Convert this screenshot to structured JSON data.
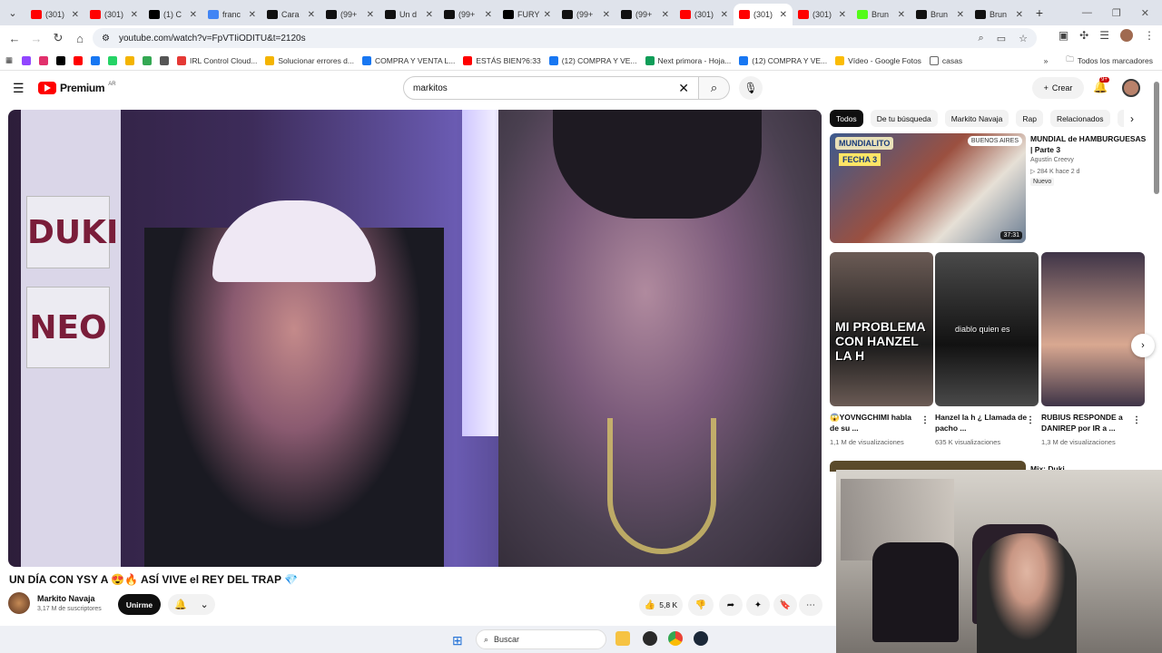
{
  "browser": {
    "tabs": [
      {
        "label": "(301)",
        "color": "#ff0000"
      },
      {
        "label": "(301)",
        "color": "#ff0000"
      },
      {
        "label": "(1) C",
        "color": "#000000"
      },
      {
        "label": "franc",
        "color": "#4285f4"
      },
      {
        "label": "Cara",
        "color": "#111111"
      },
      {
        "label": "(99+",
        "color": "#111111"
      },
      {
        "label": "Un d",
        "color": "#111111"
      },
      {
        "label": "(99+",
        "color": "#111111"
      },
      {
        "label": "FURY",
        "color": "#000000"
      },
      {
        "label": "(99+",
        "color": "#111111"
      },
      {
        "label": "(99+",
        "color": "#111111"
      },
      {
        "label": "(301)",
        "color": "#ff0000"
      },
      {
        "label": "(301)",
        "color": "#ff0000",
        "active": true
      },
      {
        "label": "(301)",
        "color": "#ff0000"
      },
      {
        "label": "Brun",
        "color": "#53fc18"
      },
      {
        "label": "Brun",
        "color": "#111111"
      },
      {
        "label": "Brun",
        "color": "#111111"
      }
    ],
    "url": "youtube.com/watch?v=FpVTIiODITU&t=2120s",
    "bookmarks": [
      {
        "label": "",
        "color": "#9146ff"
      },
      {
        "label": "",
        "color": "#e1306c"
      },
      {
        "label": "",
        "color": "#000000"
      },
      {
        "label": "",
        "color": "#ff0000"
      },
      {
        "label": "",
        "color": "#1877f2"
      },
      {
        "label": "",
        "color": "#25d366"
      },
      {
        "label": "",
        "color": "#f4b400"
      },
      {
        "label": "",
        "color": "#34a853"
      },
      {
        "label": "",
        "color": "#555555"
      },
      {
        "label": "IRL Control Cloud...",
        "color": "#e53935"
      },
      {
        "label": "Solucionar errores d...",
        "color": "#f4b400"
      },
      {
        "label": "COMPRA Y VENTA L...",
        "color": "#1877f2"
      },
      {
        "label": "ESTÁS BIEN?6:33",
        "color": "#ff0000"
      },
      {
        "label": "(12) COMPRA Y VE...",
        "color": "#1877f2"
      },
      {
        "label": "Next primora - Hoja...",
        "color": "#0f9d58"
      },
      {
        "label": "(12) COMPRA Y VE...",
        "color": "#1877f2"
      },
      {
        "label": "Vídeo - Google Fotos",
        "color": "#fbbc04"
      },
      {
        "label": "casas",
        "color": "#ffffff"
      }
    ],
    "all_bookmarks": "Todos los marcadores"
  },
  "youtube": {
    "logo_text": "Premium",
    "region": "AR",
    "search_query": "markitos",
    "create_label": "Crear",
    "notifications_badge": "9+"
  },
  "video": {
    "title": "UN DÍA CON YSY A 😍🔥 ASÍ VIVE el REY DEL TRAP 💎",
    "sign_top": "DUKI",
    "sign_bottom": "NEO",
    "channel": "Markito Navaja",
    "subscribers": "3,17 M de suscriptores",
    "join_label": "Unirme",
    "likes": "5,8 K"
  },
  "chips": [
    "Todos",
    "De tu búsqueda",
    "Markito Navaja",
    "Rap",
    "Relacionados",
    "P"
  ],
  "recommendation": {
    "title": "MUNDIAL de HAMBURGUESAS | Parte 3",
    "channel": "Agustín Creevy",
    "meta": "▷ 284 K   hace 2 d",
    "new_badge": "Nuevo",
    "duration": "37:31",
    "thumb_badge": "MUNDIALITO",
    "thumb_fecha": "FECHA 3",
    "thumb_location": "BUENOS AIRES"
  },
  "shorts": [
    {
      "title": "😱YOVNGCHIMI habla de su ...",
      "views": "1,1 M de visualizaciones",
      "caption": "MI PROBLEMA CON HANZEL LA H",
      "colors": [
        "#1b1b1b",
        "#6b5b55"
      ]
    },
    {
      "title": "Hanzel la h ¿ Llamada de pacho ...",
      "views": "635 K visualizaciones",
      "caption": "diablo quien es",
      "colors": [
        "#121212",
        "#4a4a4a"
      ]
    },
    {
      "title": "RUBIUS RESPONDE a DANIREP por IR a ...",
      "views": "1,3 M de visualizaciones",
      "caption": "",
      "colors": [
        "#d9a891",
        "#3e3447"
      ]
    }
  ],
  "mix_label": "Mix: Duki",
  "taskbar": {
    "search_placeholder": "Buscar"
  }
}
